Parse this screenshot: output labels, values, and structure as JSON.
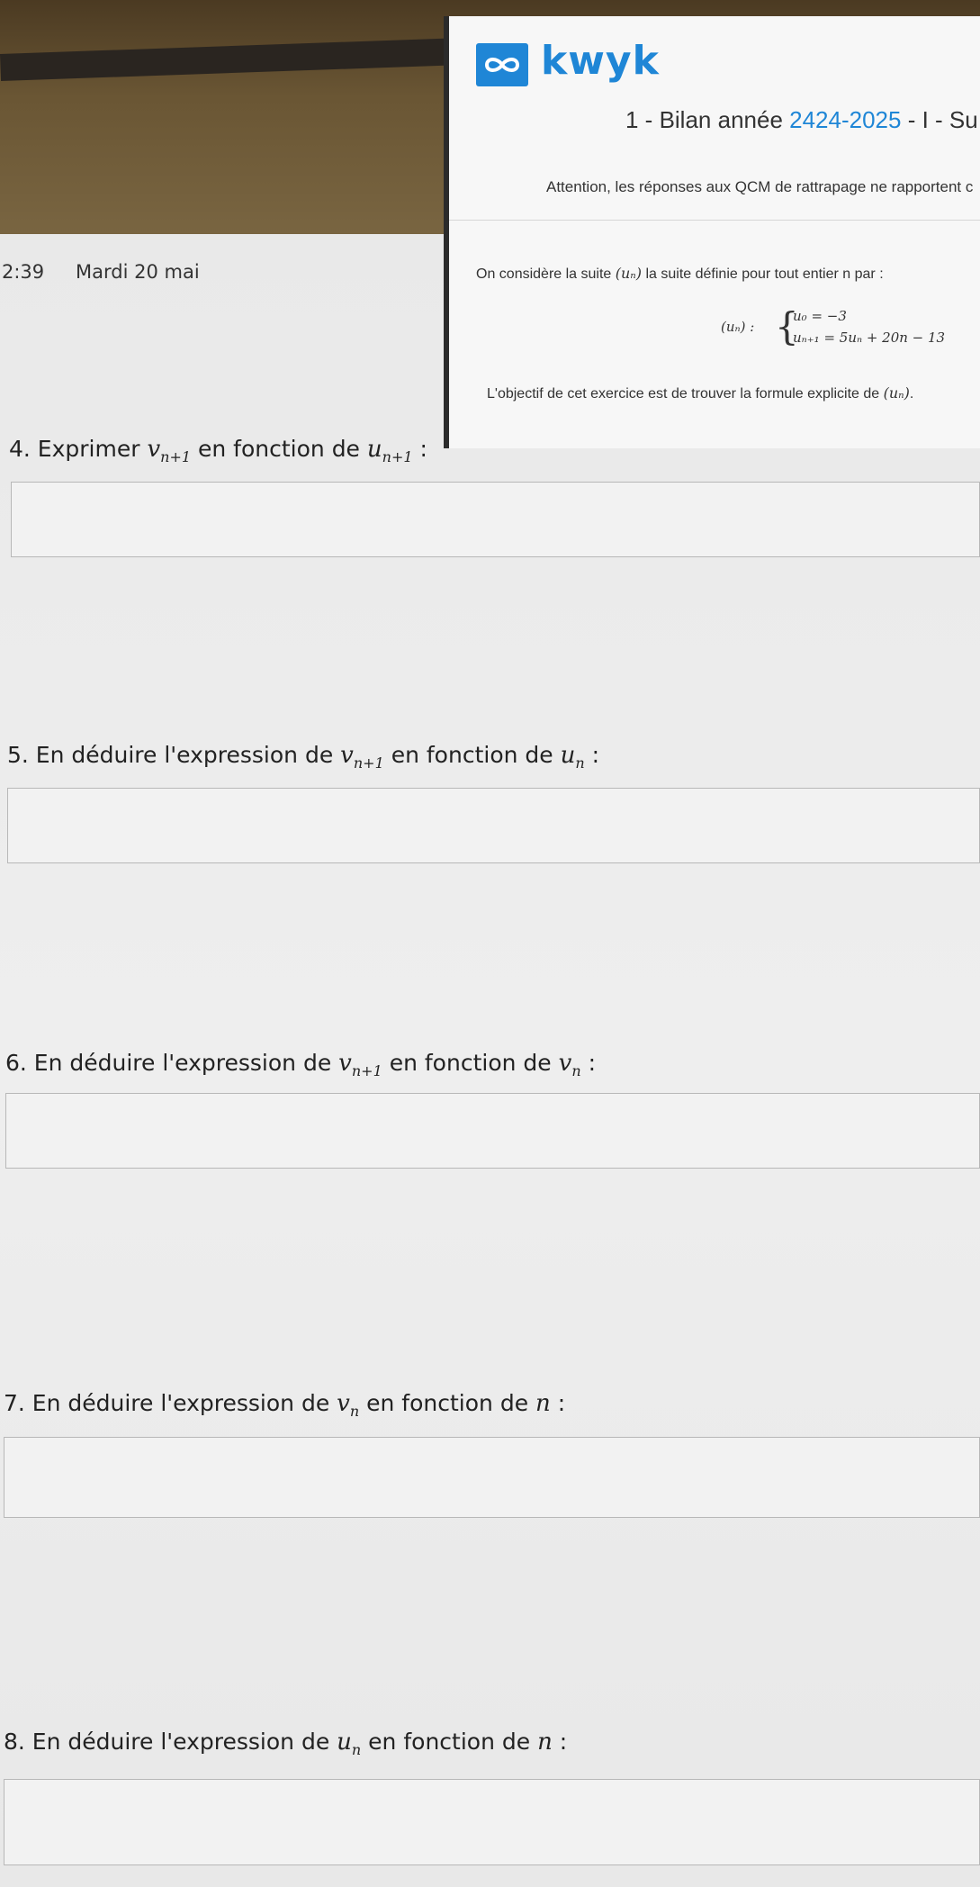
{
  "status": {
    "time": "2:39",
    "date": "Mardi 20 mai"
  },
  "kwyk": {
    "brand": "kwyk",
    "title_prefix": "1 - Bilan année ",
    "title_year": "2424-2025",
    "title_suffix": " - I - Su",
    "warning": "Attention, les réponses aux QCM de rattrapage ne rapportent c",
    "intro_before": "On considère la suite ",
    "intro_seq": "(uₙ)",
    "intro_after": " la suite définie pour tout entier n par :",
    "def_label": "(uₙ) :",
    "def_line1": "u₀ = −3",
    "def_line2": "uₙ₊₁ = 5uₙ + 20n − 13",
    "objective_before": "L'objectif de cet exercice est de trouver la formule explicite de ",
    "objective_seq": "(uₙ)",
    "objective_after": "."
  },
  "questions": [
    {
      "number_text": "4. Exprimer ",
      "var1": "v",
      "sub1": "n+1",
      "mid": " en fonction de ",
      "var2": "u",
      "sub2": "n+1",
      "end": " :"
    },
    {
      "number_text": "5. En déduire l'expression de ",
      "var1": "v",
      "sub1": "n+1",
      "mid": " en fonction de ",
      "var2": "u",
      "sub2": "n",
      "end": " :"
    },
    {
      "number_text": "6. En déduire l'expression de ",
      "var1": "v",
      "sub1": "n+1",
      "mid": " en fonction de ",
      "var2": "v",
      "sub2": "n",
      "end": " :"
    },
    {
      "number_text": "7. En déduire l'expression de ",
      "var1": "v",
      "sub1": "n",
      "mid": " en fonction de ",
      "var2": "n",
      "sub2": "",
      "end": " :"
    },
    {
      "number_text": "8. En déduire l'expression de ",
      "var1": "u",
      "sub1": "n",
      "mid": " en fonction de ",
      "var2": "n",
      "sub2": "",
      "end": " :"
    }
  ],
  "colors": {
    "brand_blue": "#1f86d6",
    "text": "#222222",
    "box_bg": "#f2f2f2"
  }
}
